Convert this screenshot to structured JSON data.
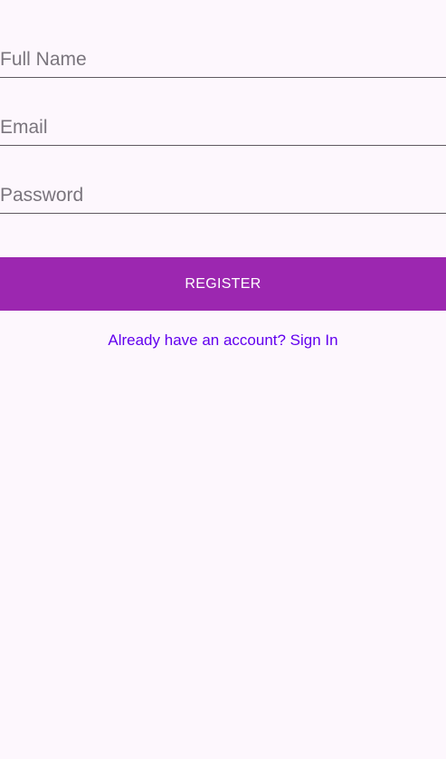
{
  "form": {
    "full_name": {
      "value": "",
      "placeholder": "Full Name"
    },
    "email": {
      "value": "",
      "placeholder": "Email"
    },
    "password": {
      "value": "",
      "placeholder": "Password"
    }
  },
  "register_button": {
    "label": "REGISTER"
  },
  "signin_link": {
    "label": "Already have an account? Sign In"
  },
  "colors": {
    "background": "#fdf7fd",
    "primary": "#9c27b0",
    "link": "#6200ee",
    "underline": "#5f5a61",
    "placeholder": "#7a757d"
  }
}
